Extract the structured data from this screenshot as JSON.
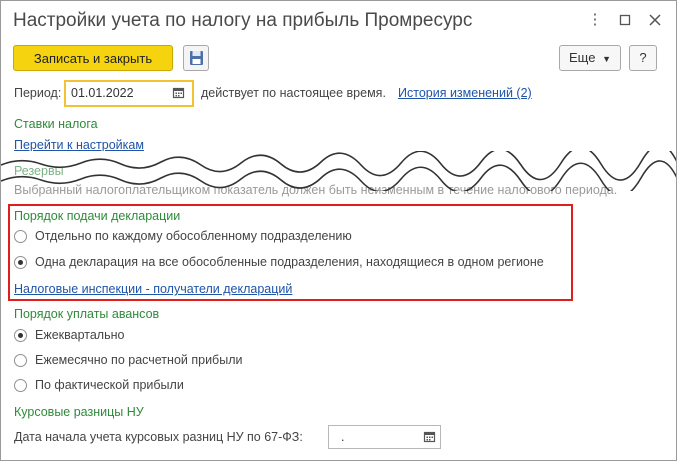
{
  "window": {
    "title": "Настройки учета по налогу на прибыль Промресурс"
  },
  "toolbar": {
    "save_close_label": "Записать и закрыть",
    "more_label": "Еще",
    "help_label": "?"
  },
  "period": {
    "label": "Период:",
    "value": "01.01.2022",
    "status_text": "действует по настоящее время.",
    "history_link": "История изменений (2)"
  },
  "tax_rates": {
    "heading": "Ставки налога",
    "link": "Перейти к настройкам"
  },
  "reserves": {
    "heading_partial": "Резервы",
    "note": "Выбранный налогоплательщиком показатель должен быть неизменным в течение налогового периода."
  },
  "declaration": {
    "heading": "Порядок подачи декларации",
    "options": [
      {
        "label": "Отдельно по каждому обособленному подразделению",
        "selected": false
      },
      {
        "label": "Одна декларация на все обособленные подразделения, находящиеся в одном регионе",
        "selected": true
      }
    ],
    "link": "Налоговые инспекции - получатели деклараций"
  },
  "advances": {
    "heading": "Порядок уплаты авансов",
    "options": [
      {
        "label": "Ежеквартально",
        "selected": true
      },
      {
        "label": "Ежемесячно по расчетной прибыли",
        "selected": false
      },
      {
        "label": "По фактической прибыли",
        "selected": false
      }
    ]
  },
  "exchange": {
    "heading": "Курсовые разницы НУ",
    "date_label": "Дата начала учета курсовых разниц НУ по 67-ФЗ:",
    "date_value": "  ."
  }
}
